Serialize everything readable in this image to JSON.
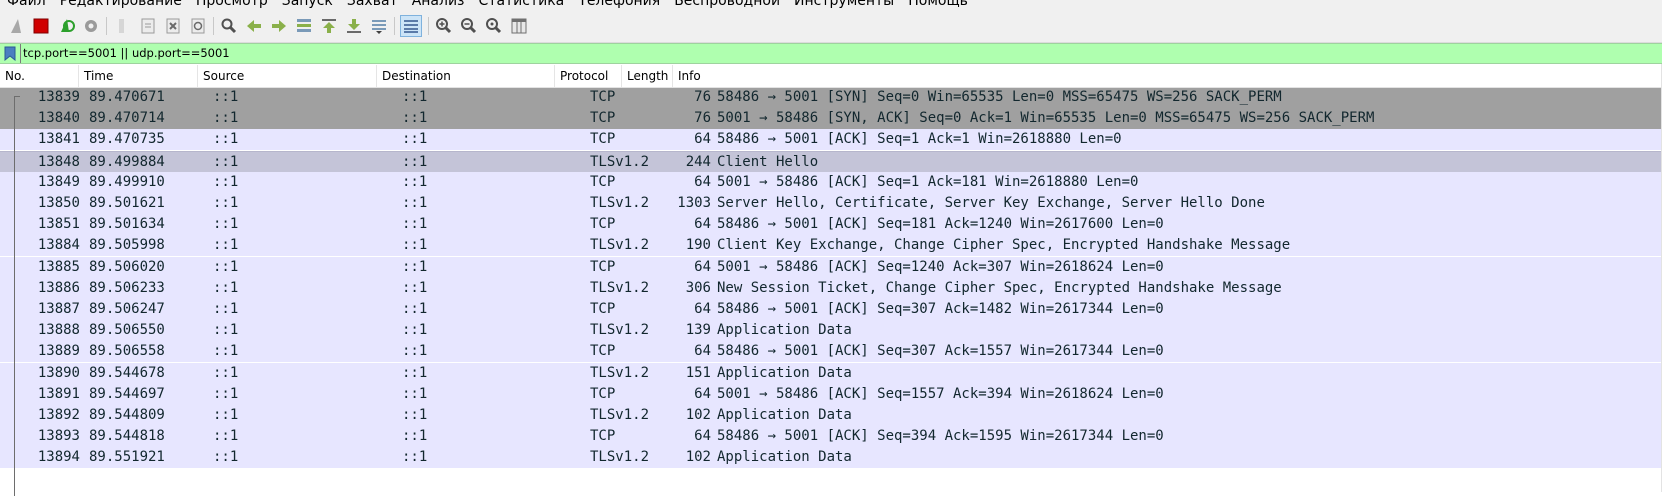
{
  "menu": [
    "Файл",
    "Редактирование",
    "Просмотр",
    "Запуск",
    "Захват",
    "Анализ",
    "Статистика",
    "Телефония",
    "Беспроводной",
    "Инструменты",
    "Помощь"
  ],
  "filter": {
    "value": "tcp.port==5001 || udp.port==5001"
  },
  "columns": {
    "no": "No.",
    "time": "Time",
    "source": "Source",
    "destination": "Destination",
    "protocol": "Protocol",
    "length": "Length",
    "info": "Info"
  },
  "colors": {
    "syn_row": "#a0a0a0",
    "selected_row": "#c4c4d8",
    "tcp_row": "#e7e6ff",
    "tls_row": "#e7e6ff",
    "filter_ok": "#afffaf"
  },
  "packets": [
    {
      "no": "13839",
      "time": "89.470671",
      "src": "::1",
      "dst": "::1",
      "proto": "TCP",
      "len": "76",
      "info": "58486 → 5001 [SYN] Seq=0 Win=65535 Len=0 MSS=65475 WS=256 SACK_PERM",
      "style": "syn"
    },
    {
      "no": "13840",
      "time": "89.470714",
      "src": "::1",
      "dst": "::1",
      "proto": "TCP",
      "len": "76",
      "info": "5001 → 58486 [SYN, ACK] Seq=0 Ack=1 Win=65535 Len=0 MSS=65475 WS=256 SACK_PERM",
      "style": "syn"
    },
    {
      "no": "13841",
      "time": "89.470735",
      "src": "::1",
      "dst": "::1",
      "proto": "TCP",
      "len": "64",
      "info": "58486 → 5001 [ACK] Seq=1 Ack=1 Win=2618880 Len=0",
      "style": "tcp"
    },
    {
      "no": "13848",
      "time": "89.499884",
      "src": "::1",
      "dst": "::1",
      "proto": "TLSv1.2",
      "len": "244",
      "info": "Client Hello",
      "style": "selected"
    },
    {
      "no": "13849",
      "time": "89.499910",
      "src": "::1",
      "dst": "::1",
      "proto": "TCP",
      "len": "64",
      "info": "5001 → 58486 [ACK] Seq=1 Ack=181 Win=2618880 Len=0",
      "style": "tcp"
    },
    {
      "no": "13850",
      "time": "89.501621",
      "src": "::1",
      "dst": "::1",
      "proto": "TLSv1.2",
      "len": "1303",
      "info": "Server Hello, Certificate, Server Key Exchange, Server Hello Done",
      "style": "tls"
    },
    {
      "no": "13851",
      "time": "89.501634",
      "src": "::1",
      "dst": "::1",
      "proto": "TCP",
      "len": "64",
      "info": "58486 → 5001 [ACK] Seq=181 Ack=1240 Win=2617600 Len=0",
      "style": "tcp"
    },
    {
      "no": "13884",
      "time": "89.505998",
      "src": "::1",
      "dst": "::1",
      "proto": "TLSv1.2",
      "len": "190",
      "info": "Client Key Exchange, Change Cipher Spec, Encrypted Handshake Message",
      "style": "tls"
    },
    {
      "no": "13885",
      "time": "89.506020",
      "src": "::1",
      "dst": "::1",
      "proto": "TCP",
      "len": "64",
      "info": "5001 → 58486 [ACK] Seq=1240 Ack=307 Win=2618624 Len=0",
      "style": "tcp"
    },
    {
      "no": "13886",
      "time": "89.506233",
      "src": "::1",
      "dst": "::1",
      "proto": "TLSv1.2",
      "len": "306",
      "info": "New Session Ticket, Change Cipher Spec, Encrypted Handshake Message",
      "style": "tls"
    },
    {
      "no": "13887",
      "time": "89.506247",
      "src": "::1",
      "dst": "::1",
      "proto": "TCP",
      "len": "64",
      "info": "58486 → 5001 [ACK] Seq=307 Ack=1482 Win=2617344 Len=0",
      "style": "tcp"
    },
    {
      "no": "13888",
      "time": "89.506550",
      "src": "::1",
      "dst": "::1",
      "proto": "TLSv1.2",
      "len": "139",
      "info": "Application Data",
      "style": "tls"
    },
    {
      "no": "13889",
      "time": "89.506558",
      "src": "::1",
      "dst": "::1",
      "proto": "TCP",
      "len": "64",
      "info": "58486 → 5001 [ACK] Seq=307 Ack=1557 Win=2617344 Len=0",
      "style": "tcp"
    },
    {
      "no": "13890",
      "time": "89.544678",
      "src": "::1",
      "dst": "::1",
      "proto": "TLSv1.2",
      "len": "151",
      "info": "Application Data",
      "style": "tls"
    },
    {
      "no": "13891",
      "time": "89.544697",
      "src": "::1",
      "dst": "::1",
      "proto": "TCP",
      "len": "64",
      "info": "5001 → 58486 [ACK] Seq=1557 Ack=394 Win=2618624 Len=0",
      "style": "tcp"
    },
    {
      "no": "13892",
      "time": "89.544809",
      "src": "::1",
      "dst": "::1",
      "proto": "TLSv1.2",
      "len": "102",
      "info": "Application Data",
      "style": "tls"
    },
    {
      "no": "13893",
      "time": "89.544818",
      "src": "::1",
      "dst": "::1",
      "proto": "TCP",
      "len": "64",
      "info": "58486 → 5001 [ACK] Seq=394 Ack=1595 Win=2617344 Len=0",
      "style": "tcp"
    },
    {
      "no": "13894",
      "time": "89.551921",
      "src": "::1",
      "dst": "::1",
      "proto": "TLSv1.2",
      "len": "102",
      "info": "Application Data",
      "style": "tls"
    }
  ]
}
